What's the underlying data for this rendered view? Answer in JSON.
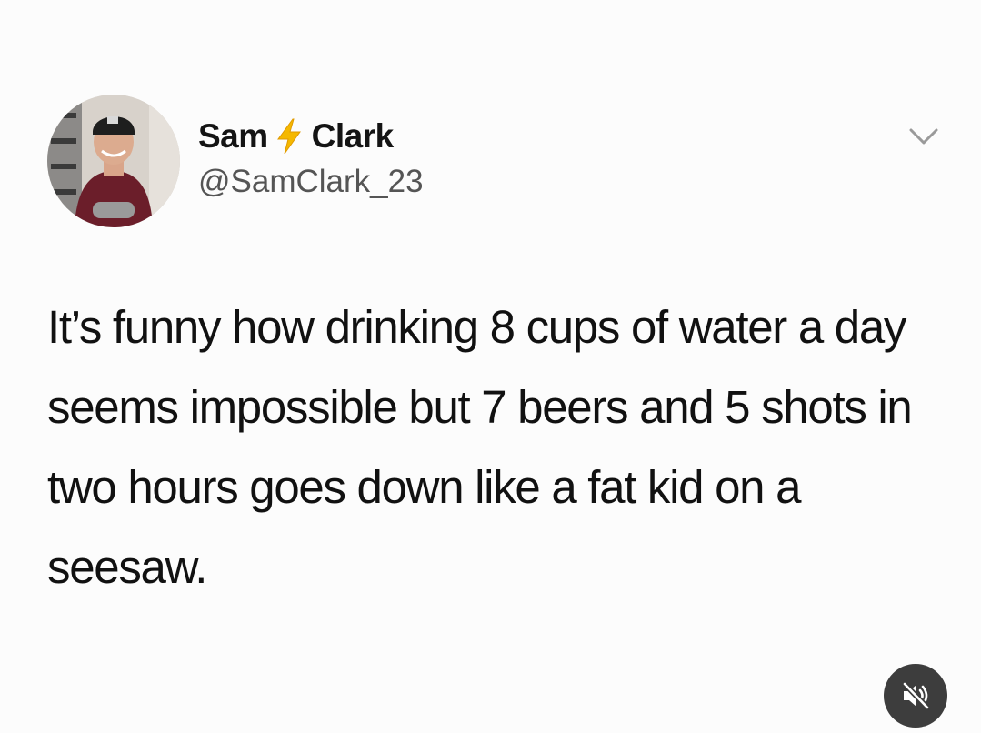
{
  "tweet": {
    "author": {
      "name_first": "Sam",
      "name_last": "Clark",
      "name_emoji": "lightning-bolt-icon",
      "handle": "@SamClark_23"
    },
    "text": "It’s funny how drinking 8 cups of water a day seems impossible but 7 beers and 5 shots in two hours goes down like a fat kid on a seesaw."
  },
  "icons": {
    "menu": "chevron-down-icon",
    "sound": "volume-muted-icon"
  },
  "colors": {
    "bolt": "#f5b800",
    "mute_button_bg": "#3d3d3d",
    "handle_text": "#555555"
  }
}
